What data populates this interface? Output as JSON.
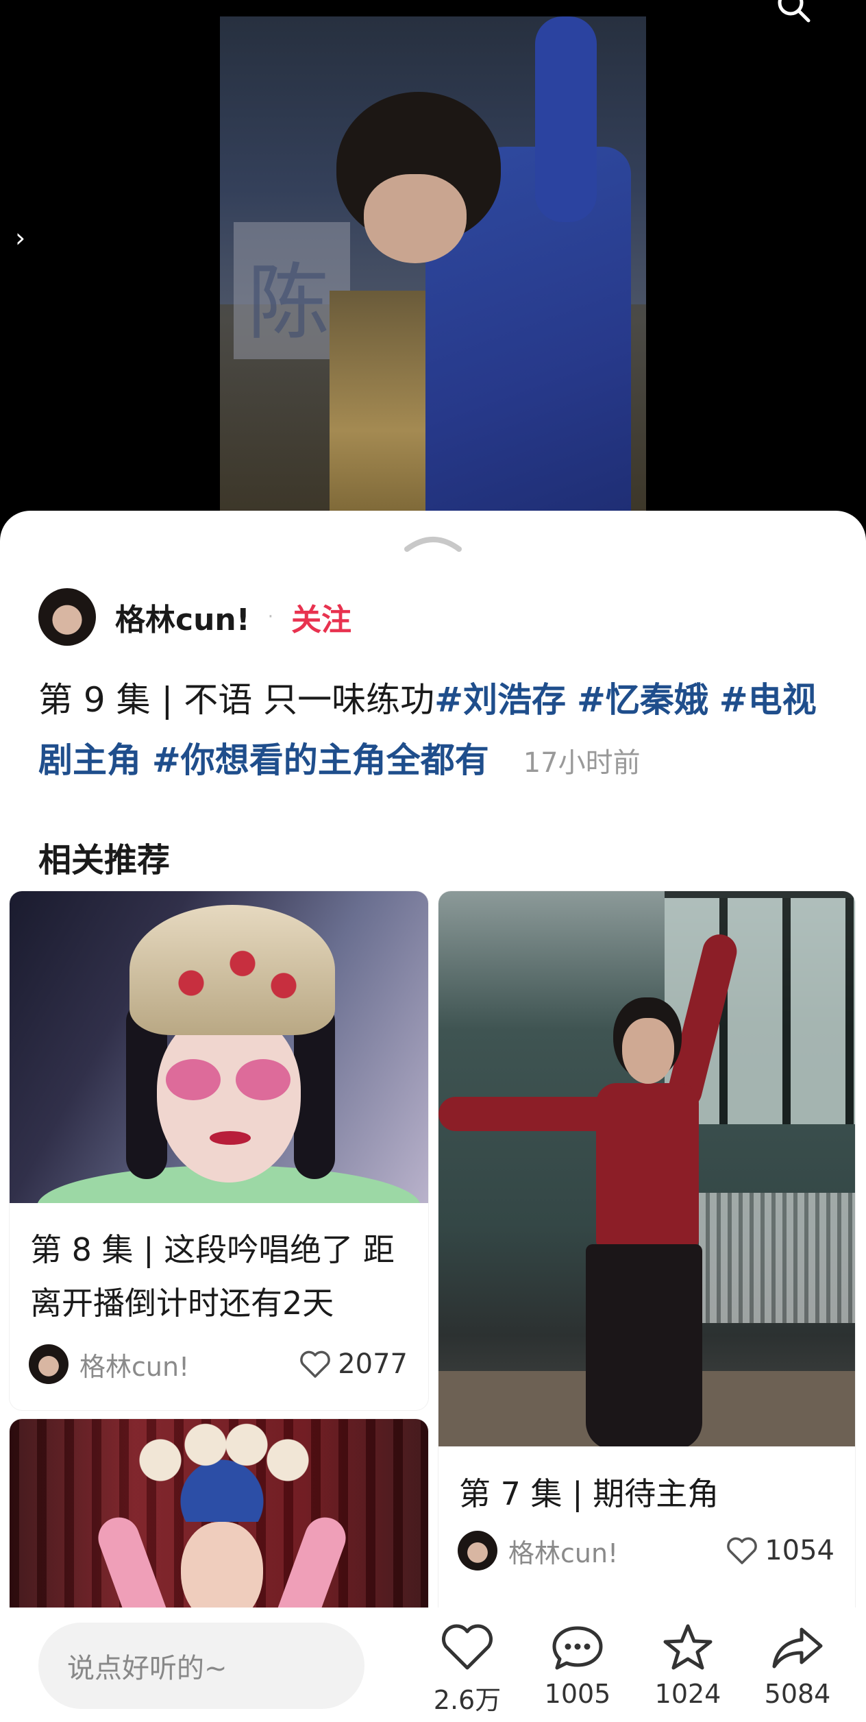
{
  "video": {
    "sign_char": "陈"
  },
  "post": {
    "author": "格林cun!",
    "follow_label": "关注",
    "caption_text": "第 9 集 | 不语 只一味练功",
    "hashtags": [
      "#刘浩存",
      "#忆秦娥",
      "#电视剧主角",
      "#你想看的主角全都有"
    ],
    "time_ago": "17小时前"
  },
  "related": {
    "title": "相关推荐",
    "cards": [
      {
        "title_line1": "第 8 集 | 这段吟唱绝了 距",
        "title_line2": "离开播倒计时还有2天",
        "author": "格林cun!",
        "likes": "2077"
      },
      {
        "title_line1": "第 7 集 | 期待主角",
        "author": "格林cun!",
        "likes": "1054"
      },
      {
        "title_line1": ""
      }
    ]
  },
  "bottom_bar": {
    "comment_placeholder": "说点好听的~",
    "like_count": "2.6万",
    "comment_count": "1005",
    "favorite_count": "1024",
    "share_count": "5084"
  },
  "colors": {
    "accent_red": "#e8324f",
    "hashtag_blue": "#1f4e8c"
  },
  "icons": [
    "search-icon",
    "chevron-right-icon",
    "chevron-up-icon",
    "heart-icon",
    "comment-icon",
    "star-icon",
    "share-icon"
  ]
}
